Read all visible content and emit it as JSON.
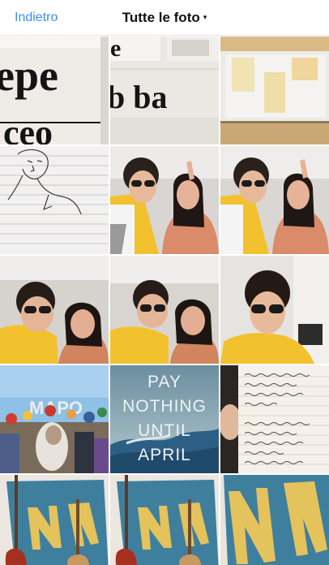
{
  "navbar": {
    "back_label": "Indietro",
    "album_title": "Tutte le foto",
    "caret": "▾"
  },
  "photos": [
    {
      "subject": "typography poster",
      "text_top": "epe",
      "text_bottom": "ceo"
    },
    {
      "subject": "typography poster",
      "text_top": "e",
      "text_bottom": "b ba"
    },
    {
      "subject": "paper notes on wall"
    },
    {
      "subject": "pencil sketch on lined paper"
    },
    {
      "subject": "selfie two friends"
    },
    {
      "subject": "selfie two friends"
    },
    {
      "subject": "selfie two friends"
    },
    {
      "subject": "selfie two friends"
    },
    {
      "subject": "selfie with sunglasses"
    },
    {
      "subject": "carnival parade crowd",
      "sign_text": "MAPO"
    },
    {
      "subject": "poster",
      "text": "PAY NOTHING UNTIL APRIL"
    },
    {
      "subject": "handwritten notebook page"
    },
    {
      "subject": "guitars and flag"
    },
    {
      "subject": "guitars and flag"
    },
    {
      "subject": "flag on wall"
    }
  ],
  "colors": {
    "link": "#3a8ff7",
    "hoodie_yellow": "#f2c12e",
    "flag_blue": "#3f7f9e",
    "flag_yellow": "#e4c25c"
  }
}
